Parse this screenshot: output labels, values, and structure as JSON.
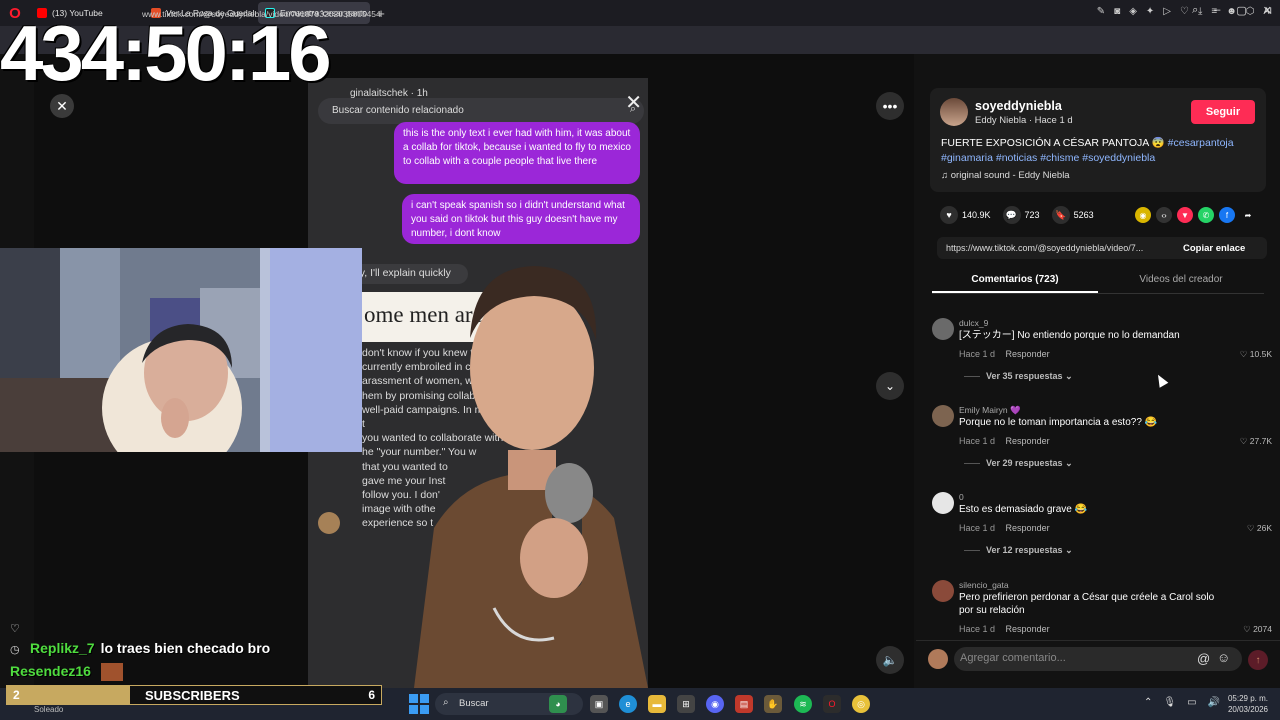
{
  "browser": {
    "tabs": [
      {
        "label": "(13) YouTube",
        "color": "#ff0000"
      },
      {
        "label": "Ver La Rosa de Guadalupe",
        "color": "#e44d26"
      },
      {
        "label": "Encuentra 'cesar panto",
        "color": "#25f4ee"
      }
    ],
    "url": "www.tiktok.com/@soyeddyniebla/video/7618793202035805454",
    "ai_label": "AI"
  },
  "stream": {
    "timer": "434:50:16",
    "chat": [
      {
        "user": "Replikz_7",
        "message": "lo traes bien checado bro"
      },
      {
        "user": "Resendez16",
        "message": ""
      }
    ],
    "sub_goal": {
      "current": "2",
      "label": "SUBSCRIBERS",
      "target": "6",
      "progress": 0.33
    }
  },
  "video": {
    "search_related": "Buscar contenido relacionado",
    "dm_user": "ginalaitschek · 1h",
    "bubble1": "this is the only text i ever had with him, it was about a collab for tiktok, because i wanted to fly to mexico to collab with a couple people that live there",
    "bubble2": "i can't speak spanish so i didn't understand what you said on tiktok but this guy doesn't have my number, i dont know",
    "reply": "don't worry, I'll explain quickly",
    "article_title": "ome men are C",
    "article_body": "don't know if you knew that this m\ncurrently embroiled in controversie\narassment of women, where he de\nhem by promising collaborations an\nwell-paid campaigns. In my case, he t\nyou wanted to collaborate with\nhe \"your number.\" You w\nthat you wanted to\ngave me your Inst\nfollow you. I don'\nimage with othe\nexperience so t\nimage with mor"
  },
  "post": {
    "author": "soyeddyniebla",
    "author_sub": "Eddy Niebla · Hace 1 d",
    "follow": "Seguir",
    "caption_text": "FUERTE EXPOSICIÓN A CÉSAR PANTOJA 😨",
    "hashtags": "#cesarpantoja #ginamaria #noticias #chisme #soyeddyniebla",
    "music": "original sound - Eddy Niebla",
    "likes": "140.9K",
    "comments": "723",
    "saves": "5263",
    "link": "https://www.tiktok.com/@soyeddyniebla/video/7...",
    "copy_link": "Copiar enlace",
    "tab_comments": "Comentarios (723)",
    "tab_creator": "Videos del creador",
    "comment_placeholder": "Agregar comentario..."
  },
  "comments": [
    {
      "user": "dulcx_9",
      "text": "[ステッカー] No entiendo porque no lo demandan",
      "time": "Hace 1 d",
      "reply": "Responder",
      "likes": "10.5K",
      "replies": "Ver 35 respuestas",
      "avatar": "#6a6a6a"
    },
    {
      "user": "Emily Mairyn 💜",
      "text": "Porque no le toman importancia a esto?? 😂",
      "time": "Hace 1 d",
      "reply": "Responder",
      "likes": "27.7K",
      "replies": "Ver 29 respuestas",
      "avatar": "#7d6450"
    },
    {
      "user": "0",
      "text": "Esto es demasiado grave 😂",
      "time": "Hace 1 d",
      "reply": "Responder",
      "likes": "26K",
      "replies": "Ver 12 respuestas",
      "avatar": "#e6e6e6"
    },
    {
      "user": "silencio_gata",
      "text": "Pero prefirieron perdonar a César que créele a Carol solo por su relación",
      "time": "Hace 1 d",
      "reply": "Responder",
      "likes": "2074",
      "replies": "",
      "avatar": "#8a4a3a"
    }
  ],
  "taskbar": {
    "weather": "Soleado",
    "search": "Buscar",
    "time": "05:29 p. m.",
    "date": "20/03/2026"
  }
}
